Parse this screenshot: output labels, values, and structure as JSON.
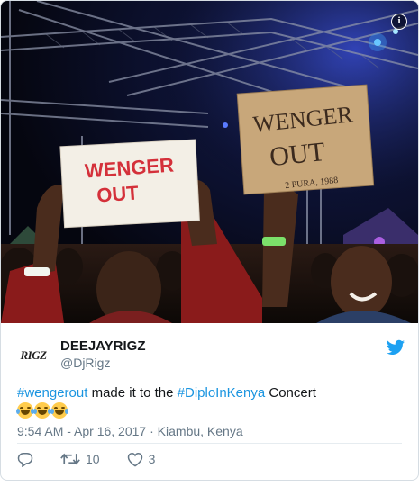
{
  "photo": {
    "sign_left_text": [
      "WENGER",
      "OUT"
    ],
    "sign_right_text": [
      "WENGER",
      "OUT"
    ],
    "sign_right_note": "2 PURA, 1988",
    "info_label": "i"
  },
  "author": {
    "avatar_mark": "RIGZ",
    "display_name": "DEEJAYRIGZ",
    "handle": "@DjRigz"
  },
  "tweet": {
    "hashtag_1": "#wengerout",
    "text_1": " made it to the ",
    "hashtag_2": "#DiploInKenya",
    "text_2": " Concert"
  },
  "meta": {
    "time": "9:54 AM - Apr 16, 2017",
    "separator": " · ",
    "location": "Kiambu, Kenya"
  },
  "actions": {
    "retweet_count": "10",
    "like_count": "3"
  },
  "colors": {
    "hashtag": "#1b95e0",
    "twitter_blue": "#1da1f2",
    "muted": "#657786"
  }
}
